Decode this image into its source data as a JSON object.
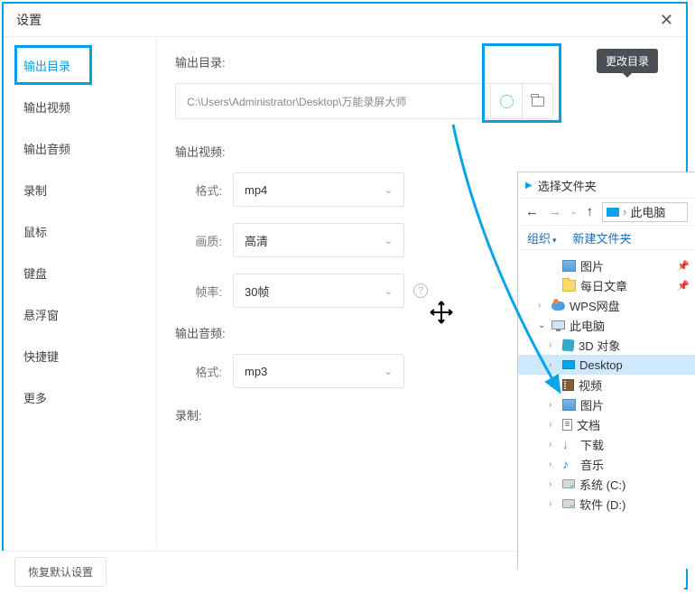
{
  "dialog": {
    "title": "设置",
    "close": "✕",
    "reset": "恢复默认设置"
  },
  "sidebar": {
    "items": [
      "输出目录",
      "输出视频",
      "输出音频",
      "录制",
      "鼠标",
      "键盘",
      "悬浮窗",
      "快捷键",
      "更多"
    ],
    "activeIndex": 0
  },
  "output_dir": {
    "label": "输出目录:",
    "path": "C:\\Users\\Administrator\\Desktop\\万能录屏大师",
    "tooltip": "更改目录"
  },
  "output_video": {
    "label": "输出视频:",
    "format_label": "格式:",
    "format_value": "mp4",
    "quality_label": "画质:",
    "quality_value": "高清",
    "fps_label": "帧率:",
    "fps_value": "30帧"
  },
  "output_audio": {
    "label": "输出音频:",
    "format_label": "格式:",
    "format_value": "mp3"
  },
  "record": {
    "label": "录制:"
  },
  "picker": {
    "title": "选择文件夹",
    "crumb": "此电脑",
    "org": "组织",
    "newf": "新建文件夹",
    "tree": [
      {
        "label": "图片",
        "icon": "ic-img",
        "depth": 2,
        "pin": true
      },
      {
        "label": "每日文章",
        "icon": "ic-fold",
        "depth": 2,
        "pin": true
      },
      {
        "label": "WPS网盘",
        "icon": "ic-cloud",
        "depth": 1,
        "exp": "›"
      },
      {
        "label": "此电脑",
        "icon": "ic-pc",
        "depth": 1,
        "exp": "⌄"
      },
      {
        "label": "3D 对象",
        "icon": "ic-3d",
        "depth": 2,
        "exp": "›"
      },
      {
        "label": "Desktop",
        "icon": "ic-desk",
        "depth": 2,
        "exp": "›",
        "sel": true
      },
      {
        "label": "视频",
        "icon": "ic-vid",
        "depth": 2,
        "exp": "›"
      },
      {
        "label": "图片",
        "icon": "ic-img",
        "depth": 2,
        "exp": "›"
      },
      {
        "label": "文档",
        "icon": "ic-doc",
        "depth": 2,
        "exp": "›"
      },
      {
        "label": "下载",
        "icon": "ic-dl",
        "depth": 2,
        "exp": "›",
        "glyph": "↓"
      },
      {
        "label": "音乐",
        "icon": "ic-mus",
        "depth": 2,
        "exp": "›",
        "glyph": "♪"
      },
      {
        "label": "系统 (C:)",
        "icon": "ic-drv",
        "depth": 2,
        "exp": "›"
      },
      {
        "label": "软件 (D:)",
        "icon": "ic-drv",
        "depth": 2,
        "exp": "›"
      }
    ]
  }
}
